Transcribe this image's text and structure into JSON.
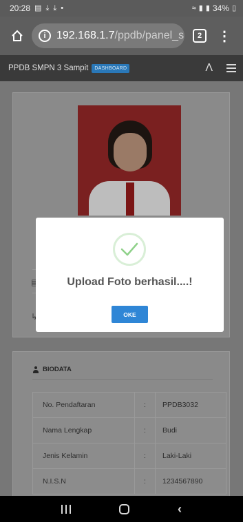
{
  "status_bar": {
    "time": "20:28",
    "notif_icons": [
      "gallery-icon",
      "download-icon",
      "download-icon",
      "dot-icon"
    ],
    "battery": "34%"
  },
  "browser": {
    "url_host": "192.168.1.7",
    "url_path": "/ppdb/panel_sis",
    "tab_count": "2"
  },
  "app": {
    "brand": "PPDB SMPN 3 Sampit",
    "badge": "DASHBOARD"
  },
  "modal": {
    "title": "Upload Foto berhasil....!",
    "ok_label": "OKE",
    "accent": "#2f86d6"
  },
  "biodata": {
    "heading": "BIODATA",
    "rows": [
      {
        "label": "No. Pendaftaran",
        "sep": ":",
        "value": "PPDB3032"
      },
      {
        "label": "Nama Lengkap",
        "sep": ":",
        "value": "Budi"
      },
      {
        "label": "Jenis Kelamin",
        "sep": ":",
        "value": "Laki-Laki"
      },
      {
        "label": "N.I.S.N",
        "sep": ":",
        "value": "1234567890"
      }
    ]
  }
}
